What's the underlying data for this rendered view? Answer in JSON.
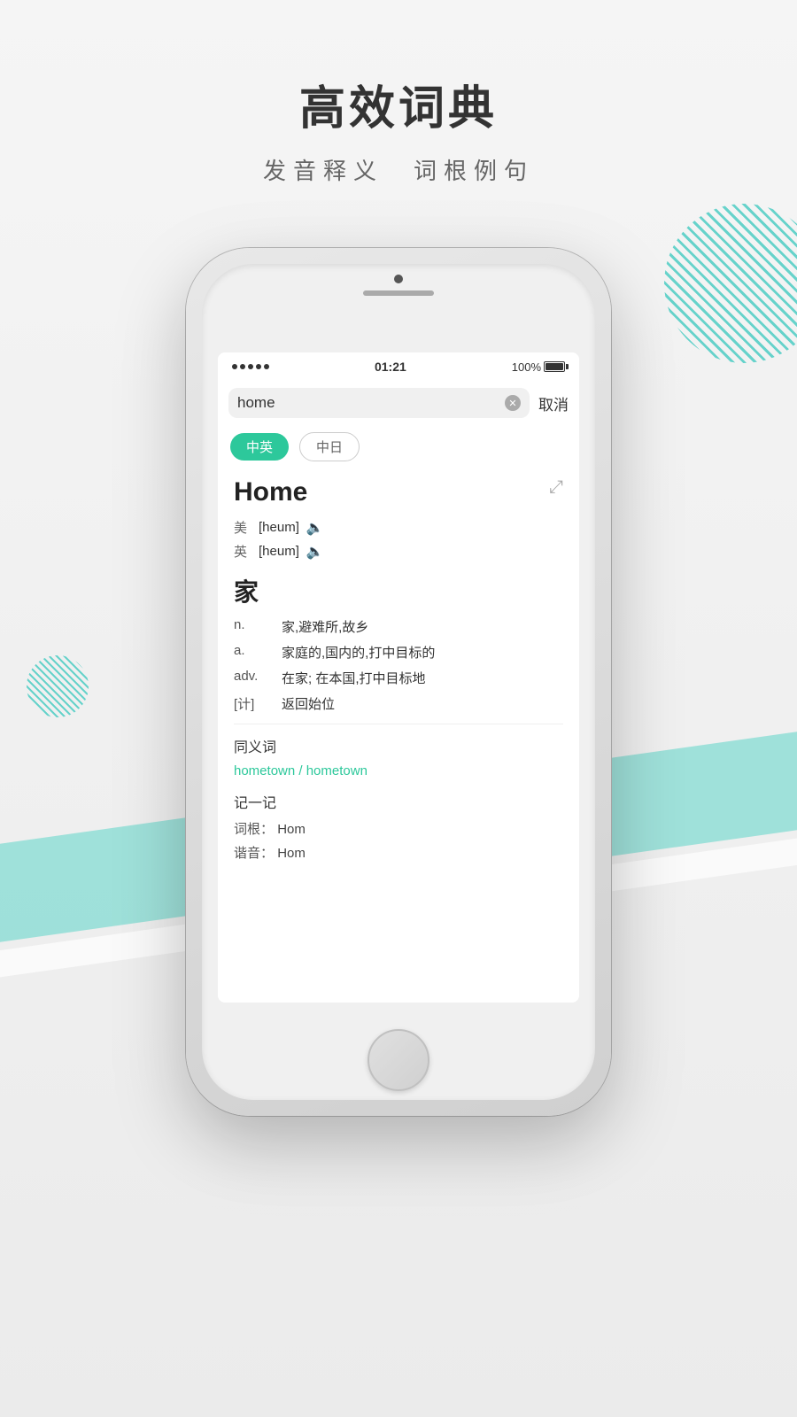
{
  "page": {
    "title": "高效词典",
    "subtitle": "发音释义　词根例句"
  },
  "status_bar": {
    "signal": "•••••",
    "time": "01:21",
    "battery": "100%"
  },
  "search": {
    "value": "home",
    "cancel_label": "取消"
  },
  "tabs": [
    {
      "label": "中英",
      "active": true
    },
    {
      "label": "中日",
      "active": false
    }
  ],
  "word": {
    "title": "Home",
    "pron_us_label": "美",
    "pron_us": "[heum]",
    "pron_uk_label": "英",
    "pron_uk": "[heum]",
    "chinese_word": "家",
    "definitions": [
      {
        "pos": "n.",
        "meaning": "家,避难所,故乡"
      },
      {
        "pos": "a.",
        "meaning": "家庭的,国内的,打中目标的"
      },
      {
        "pos": "adv.",
        "meaning": "在家; 在本国,打中目标地"
      },
      {
        "pos": "[计]",
        "meaning": "返回始位"
      }
    ],
    "synonyms_label": "同义词",
    "synonyms": "hometown / hometown",
    "memory_label": "记一记",
    "root_label": "词根：",
    "root_value": "Hom",
    "sound_label": "谐音：",
    "sound_value": "Hom"
  }
}
